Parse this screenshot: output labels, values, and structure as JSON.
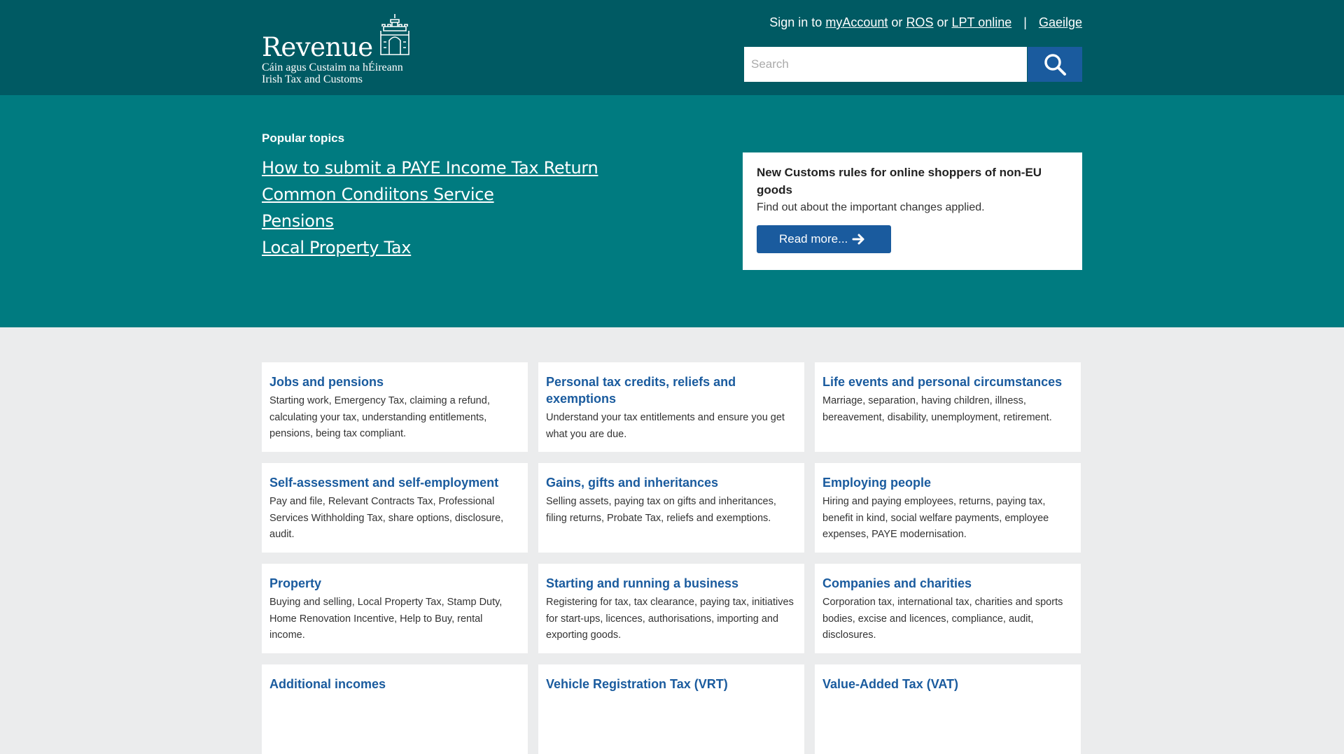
{
  "header": {
    "logo": {
      "word": "Revenue",
      "sub_line1": "Cáin agus Custaim na hÉireann",
      "sub_line2": "Irish Tax and Customs"
    },
    "signin_prefix": "Sign in to",
    "links": {
      "myaccount": "myAccount",
      "or1": "or",
      "ros": "ROS",
      "or2": "or",
      "lpt": "LPT online",
      "separator": "|",
      "gaeilge": "Gaeilge"
    },
    "search": {
      "placeholder": "Search"
    }
  },
  "hero": {
    "popular_title": "Popular topics",
    "topics": [
      "How to submit a PAYE Income Tax Return",
      "Common Condiitons Service",
      "Pensions",
      "Local Property Tax"
    ],
    "notice": {
      "title": "New Customs rules for online shoppers of non-EU goods",
      "text": "Find out about the important changes applied.",
      "button": "Read more..."
    }
  },
  "cards": [
    {
      "title": "Jobs and pensions",
      "text": "Starting work, Emergency Tax, claiming a refund, calculating your tax, understanding entitlements, pensions, being tax compliant."
    },
    {
      "title": "Personal tax credits, reliefs and exemptions",
      "text": "Understand your tax entitlements and ensure you get what you are due."
    },
    {
      "title": "Life events and personal circumstances",
      "text": "Marriage, separation, having children, illness, bereavement, disability, unemployment, retirement."
    },
    {
      "title": "Self-assessment and self-employment",
      "text": "Pay and file, Relevant Contracts Tax, Professional Services Withholding Tax, share options, disclosure, audit."
    },
    {
      "title": "Gains, gifts and inheritances",
      "text": "Selling assets, paying tax on gifts and inheritances, filing returns, Probate Tax, reliefs and exemptions."
    },
    {
      "title": "Employing people",
      "text": "Hiring and paying employees, returns, paying tax, benefit in kind, social welfare payments, employee expenses, PAYE modernisation."
    },
    {
      "title": "Property",
      "text": "Buying and selling, Local Property Tax, Stamp Duty, Home Renovation Incentive, Help to Buy, rental income."
    },
    {
      "title": "Starting and running a business",
      "text": "Registering for tax, tax clearance, paying tax, initiatives for start-ups, licences, authorisations, importing and exporting goods."
    },
    {
      "title": "Companies and charities",
      "text": "Corporation tax, international tax, charities and sports bodies, excise and licences, compliance, audit, disclosures."
    },
    {
      "title": "Additional incomes",
      "text": ""
    },
    {
      "title": "Vehicle Registration Tax (VRT)",
      "text": ""
    },
    {
      "title": "Value-Added Tax (VAT)",
      "text": ""
    }
  ],
  "colors": {
    "header_bg": "#005a63",
    "hero_bg": "#007b80",
    "accent_blue": "#1a5b9e",
    "page_bg": "#ebeced"
  }
}
